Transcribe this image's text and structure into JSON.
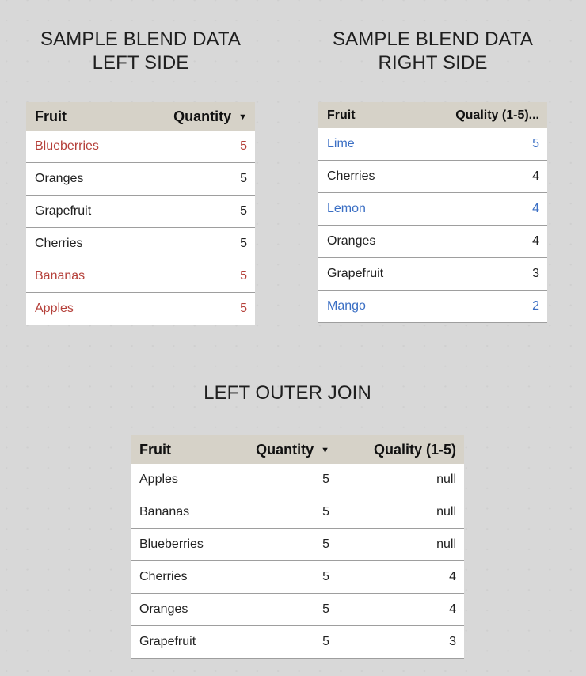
{
  "left_panel": {
    "title_line1": "SAMPLE BLEND DATA",
    "title_line2": "LEFT SIDE",
    "columns": [
      "Fruit",
      "Quantity"
    ],
    "sort_indicator": "▼",
    "rows": [
      {
        "fruit": "Blueberries",
        "quantity": "5",
        "highlight": "red"
      },
      {
        "fruit": "Oranges",
        "quantity": "5",
        "highlight": "none"
      },
      {
        "fruit": "Grapefruit",
        "quantity": "5",
        "highlight": "none"
      },
      {
        "fruit": "Cherries",
        "quantity": "5",
        "highlight": "none"
      },
      {
        "fruit": "Bananas",
        "quantity": "5",
        "highlight": "red"
      },
      {
        "fruit": "Apples",
        "quantity": "5",
        "highlight": "red"
      }
    ]
  },
  "right_panel": {
    "title_line1": "SAMPLE BLEND DATA",
    "title_line2": "RIGHT SIDE",
    "columns": [
      "Fruit",
      "Quality (1-5)..."
    ],
    "rows": [
      {
        "fruit": "Lime",
        "quality": "5",
        "highlight": "blue"
      },
      {
        "fruit": "Cherries",
        "quality": "4",
        "highlight": "none"
      },
      {
        "fruit": "Lemon",
        "quality": "4",
        "highlight": "blue"
      },
      {
        "fruit": "Oranges",
        "quality": "4",
        "highlight": "none"
      },
      {
        "fruit": "Grapefruit",
        "quality": "3",
        "highlight": "none"
      },
      {
        "fruit": "Mango",
        "quality": "2",
        "highlight": "blue"
      }
    ]
  },
  "join_panel": {
    "title": "LEFT OUTER JOIN",
    "columns": [
      "Fruit",
      "Quantity",
      "Quality (1-5)"
    ],
    "sort_indicator": "▼",
    "rows": [
      {
        "fruit": "Apples",
        "quantity": "5",
        "quality": "null"
      },
      {
        "fruit": "Bananas",
        "quantity": "5",
        "quality": "null"
      },
      {
        "fruit": "Blueberries",
        "quantity": "5",
        "quality": "null"
      },
      {
        "fruit": "Cherries",
        "quantity": "5",
        "quality": "4"
      },
      {
        "fruit": "Oranges",
        "quantity": "5",
        "quality": "4"
      },
      {
        "fruit": "Grapefruit",
        "quantity": "5",
        "quality": "3"
      }
    ]
  },
  "colors": {
    "header_bg": "#d6d2c8",
    "highlight_red": "#b5403a",
    "highlight_blue": "#3b6fc4",
    "row_divider": "#9e9e9e"
  }
}
